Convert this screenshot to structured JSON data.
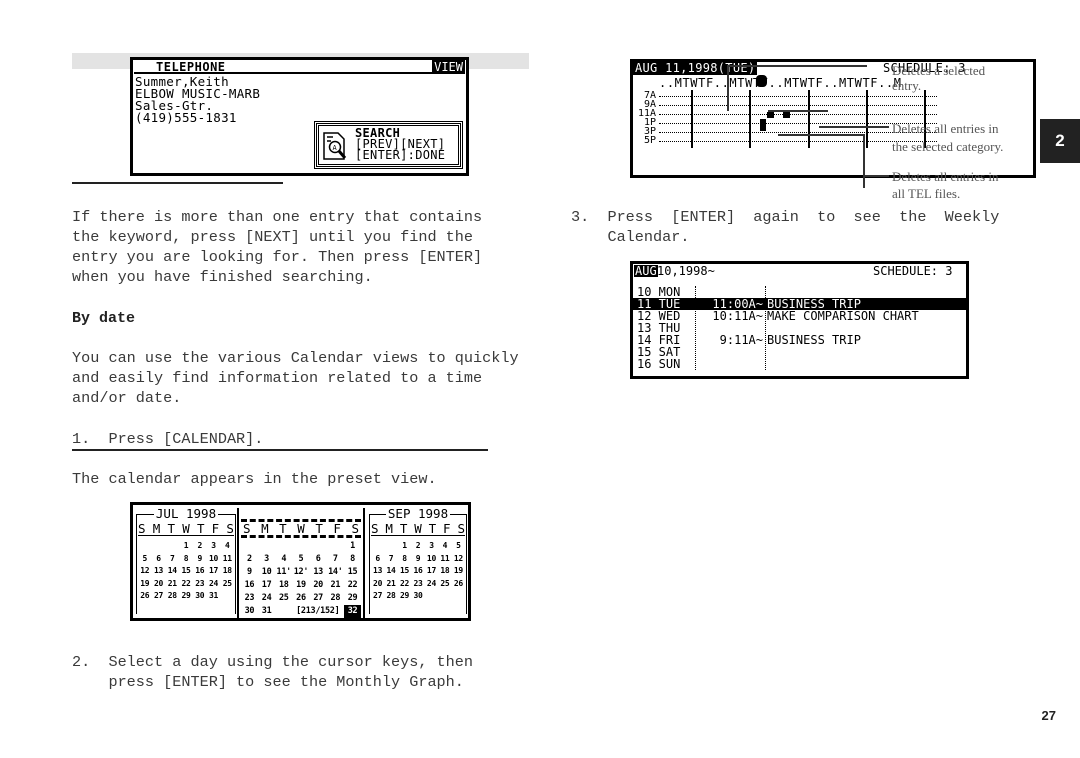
{
  "telephone_screen": {
    "title": "TELEPHONE",
    "mode": "VIEW",
    "lines": [
      "Summer,Keith",
      "ELBOW MUSIC-MARB",
      "Sales-Gtr.",
      "(419)555-1831"
    ],
    "search_popup": {
      "title": "SEARCH",
      "line2": "[PREV][NEXT]",
      "line3": "[ENTER]:DONE",
      "icon": "document-search-icon"
    }
  },
  "left_column": {
    "paragraph1": "If there is more than one entry that contains\nthe keyword, press [NEXT] until you find the\nentry you are looking for. Then press [ENTER]\nwhen you have finished searching.",
    "heading_by_date": "By date",
    "paragraph2": "You can use the various Calendar views to quickly\nand easily find information related to a time\nand/or date.",
    "step1": "1.  Press [CALENDAR].",
    "paragraph3": "The calendar appears in the preset view.",
    "step2": "2.  Select a day using the cursor keys, then\n    press [ENTER] to see the Monthly Graph."
  },
  "calendar_screen": {
    "months": [
      {
        "title": "JUL 1998",
        "dow": [
          "S",
          "M",
          "T",
          "W",
          "T",
          "F",
          "S"
        ],
        "weeks": [
          [
            "",
            "",
            "",
            "1",
            "2",
            "3",
            "4"
          ],
          [
            "5",
            "6",
            "7",
            "8",
            "9",
            "10",
            "11"
          ],
          [
            "12",
            "13",
            "14",
            "15",
            "16",
            "17",
            "18"
          ],
          [
            "19",
            "20",
            "21",
            "22",
            "23",
            "24",
            "25"
          ],
          [
            "26",
            "27",
            "28",
            "29",
            "30",
            "31",
            ""
          ]
        ]
      },
      {
        "title": "AUG 1998",
        "dow": [
          "S",
          "M",
          "T",
          "W",
          "T",
          "F",
          "S"
        ],
        "weeks": [
          [
            "",
            "",
            "",
            "",
            "",
            "",
            "1"
          ],
          [
            "2",
            "3",
            "4",
            "5",
            "6",
            "7",
            "8"
          ],
          [
            "9",
            "10",
            "11'",
            "12'",
            "13",
            "14'",
            "15"
          ],
          [
            "16",
            "17",
            "18",
            "19",
            "20",
            "21",
            "22"
          ],
          [
            "23",
            "24",
            "25",
            "26",
            "27",
            "28",
            "29"
          ],
          [
            "30",
            "31",
            "",
            "[213/152]",
            "",
            "",
            "32"
          ]
        ]
      },
      {
        "title": "SEP 1998",
        "dow": [
          "S",
          "M",
          "T",
          "W",
          "T",
          "F",
          "S"
        ],
        "weeks": [
          [
            "",
            "",
            "1",
            "2",
            "3",
            "4",
            "5"
          ],
          [
            "6",
            "7",
            "8",
            "9",
            "10",
            "11",
            "12"
          ],
          [
            "13",
            "14",
            "15",
            "16",
            "17",
            "18",
            "19"
          ],
          [
            "20",
            "21",
            "22",
            "23",
            "24",
            "25",
            "26"
          ],
          [
            "27",
            "28",
            "29",
            "30",
            "",
            "",
            ""
          ]
        ]
      }
    ]
  },
  "graph_screen": {
    "date": "AUG 11,1998(TUE)",
    "schedule_label": "SCHEDULE: 3",
    "days_header": "..MTWTF..MTWTF..MTWTF..MTWTF..M",
    "hours": [
      "7A",
      "9A",
      "11A",
      "1P",
      "3P",
      "5P"
    ]
  },
  "annotations": {
    "a1_line1": "Deletes a selected",
    "a1_line2": "entry.",
    "a2_line1": "Deletes all entries in",
    "a2_line2": "the selected category.",
    "a3_line1": "Deletes all entries in",
    "a3_line2": "all TEL files."
  },
  "right_column": {
    "step3": "3.  Press  [ENTER]  again  to  see  the  Weekly\n    Calendar."
  },
  "weekly_screen": {
    "month": "AUG",
    "date": " 10,1998~",
    "schedule_label": "SCHEDULE: 3",
    "rows": [
      {
        "day": "10 MON",
        "time": "",
        "event": "",
        "selected": false
      },
      {
        "day": "11 TUE",
        "time": "11:00A~",
        "event": "BUSINESS TRIP",
        "selected": true
      },
      {
        "day": "12 WED",
        "time": "10:11A~",
        "event": "MAKE COMPARISON CHART",
        "selected": false
      },
      {
        "day": "13 THU",
        "time": "",
        "event": "",
        "selected": false
      },
      {
        "day": "14 FRI",
        "time": "9:11A~",
        "event": "BUSINESS TRIP",
        "selected": false
      },
      {
        "day": "15 SAT",
        "time": "",
        "event": "",
        "selected": false
      },
      {
        "day": "16 SUN",
        "time": "",
        "event": "",
        "selected": false
      }
    ]
  },
  "chapter_tab": "2",
  "page_number": "27"
}
